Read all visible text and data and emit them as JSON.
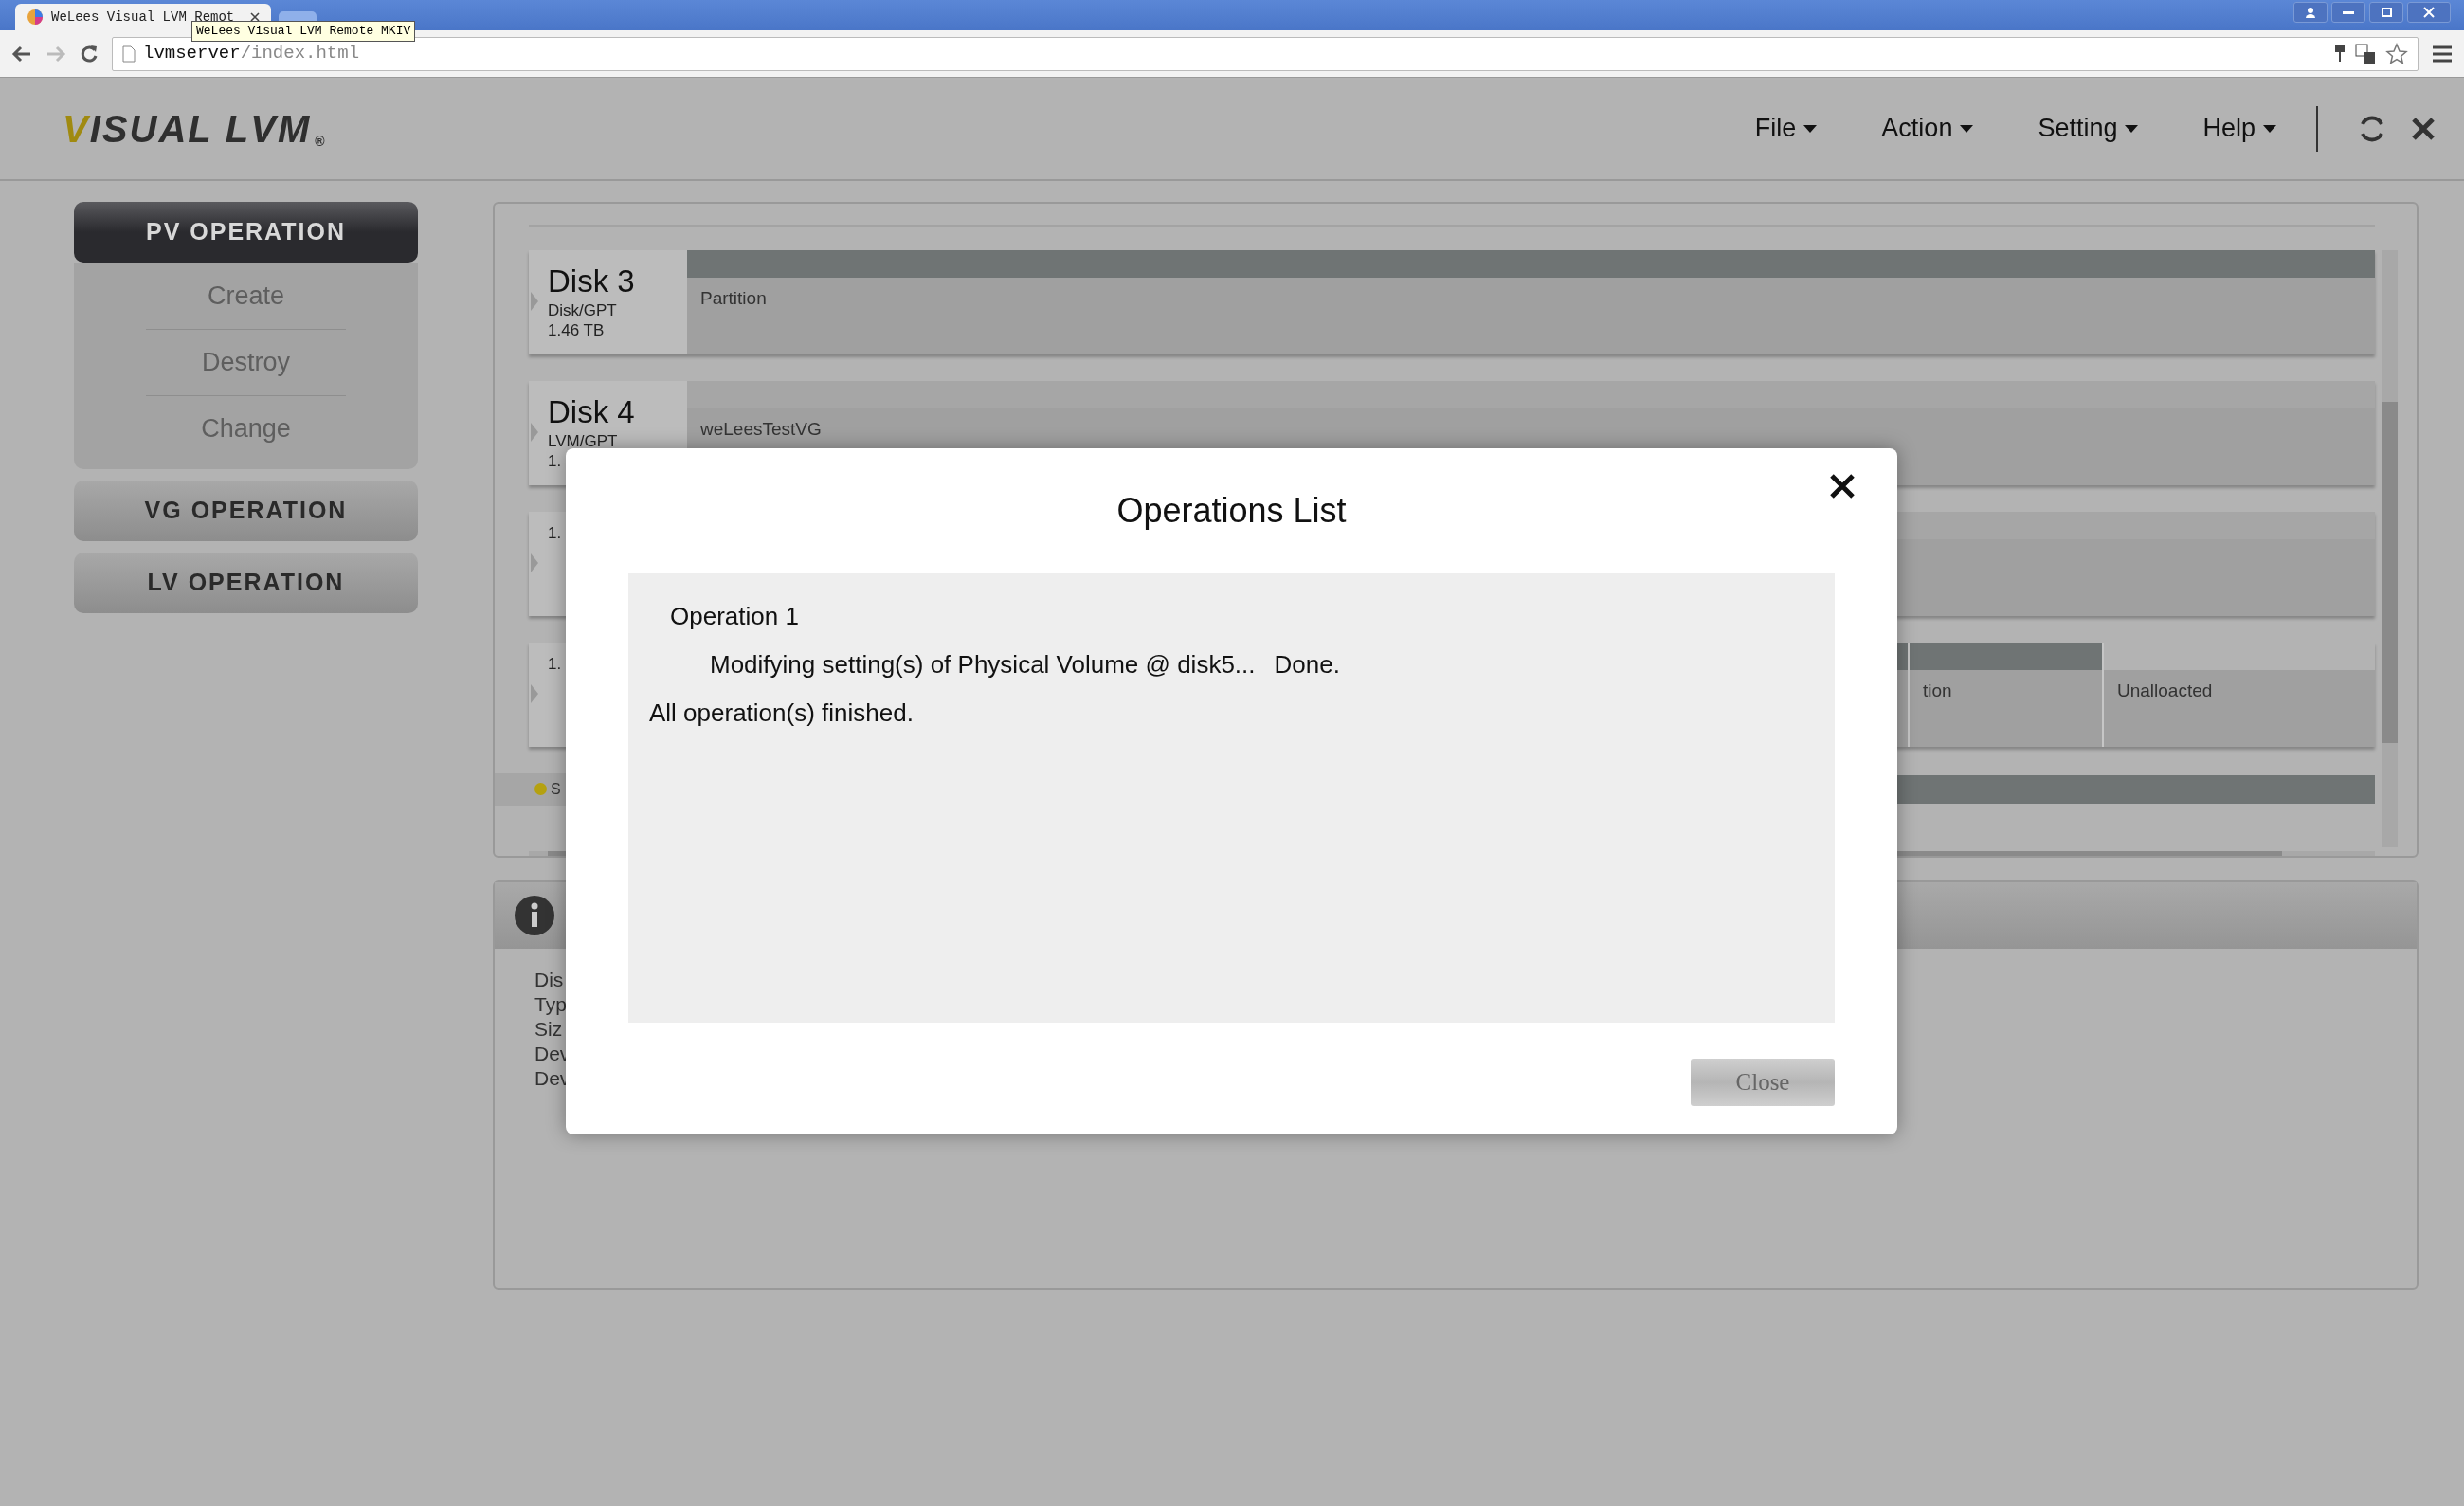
{
  "browser": {
    "tab_title": "WeLees Visual LVM Remot",
    "tooltip": "WeLees Visual LVM Remote MKIV",
    "url_host": "lvmserver",
    "url_path": "/index.html"
  },
  "app": {
    "logo": "VISUAL LVM",
    "logo_mark": "®",
    "menu": [
      {
        "label": "File"
      },
      {
        "label": "Action"
      },
      {
        "label": "Setting"
      },
      {
        "label": "Help"
      }
    ]
  },
  "sidebar": [
    {
      "title": "PV OPERATION",
      "expanded": true,
      "items": [
        "Create",
        "Destroy",
        "Change"
      ]
    },
    {
      "title": "VG OPERATION",
      "expanded": false
    },
    {
      "title": "LV OPERATION",
      "expanded": false
    }
  ],
  "disks": [
    {
      "name": "Disk 3",
      "type": "Disk/GPT",
      "size": "1.46 TB",
      "segments": [
        {
          "label": "Partition",
          "kind": "used"
        }
      ]
    },
    {
      "name": "Disk 4",
      "type": "LVM/GPT",
      "size": "1.",
      "segments": [
        {
          "label": "weLeesTestVG",
          "kind": "vg"
        }
      ]
    },
    {
      "size": "1.",
      "segments": [
        {
          "kind": "vg"
        }
      ]
    },
    {
      "size": "1.",
      "segments": [
        {
          "kind": "used"
        },
        {
          "label": "tion",
          "kind": "used"
        },
        {
          "label": "Unalloacted",
          "kind": "free"
        }
      ]
    }
  ],
  "legend": {
    "label": "S",
    "color": "#b5a110"
  },
  "info": {
    "lines": [
      "Dis",
      "Typ",
      "Siz",
      "Dev",
      "Dev"
    ]
  },
  "dialog": {
    "title": "Operations List",
    "lines": [
      {
        "kind": "header",
        "text": "Operation 1"
      },
      {
        "kind": "step",
        "text": "Modifying setting(s) of Physical Volume @ disk5...",
        "status": "Done."
      },
      {
        "kind": "summary",
        "text": "All operation(s) finished."
      }
    ],
    "close_button": {
      "label": "Close",
      "disabled": true
    }
  }
}
